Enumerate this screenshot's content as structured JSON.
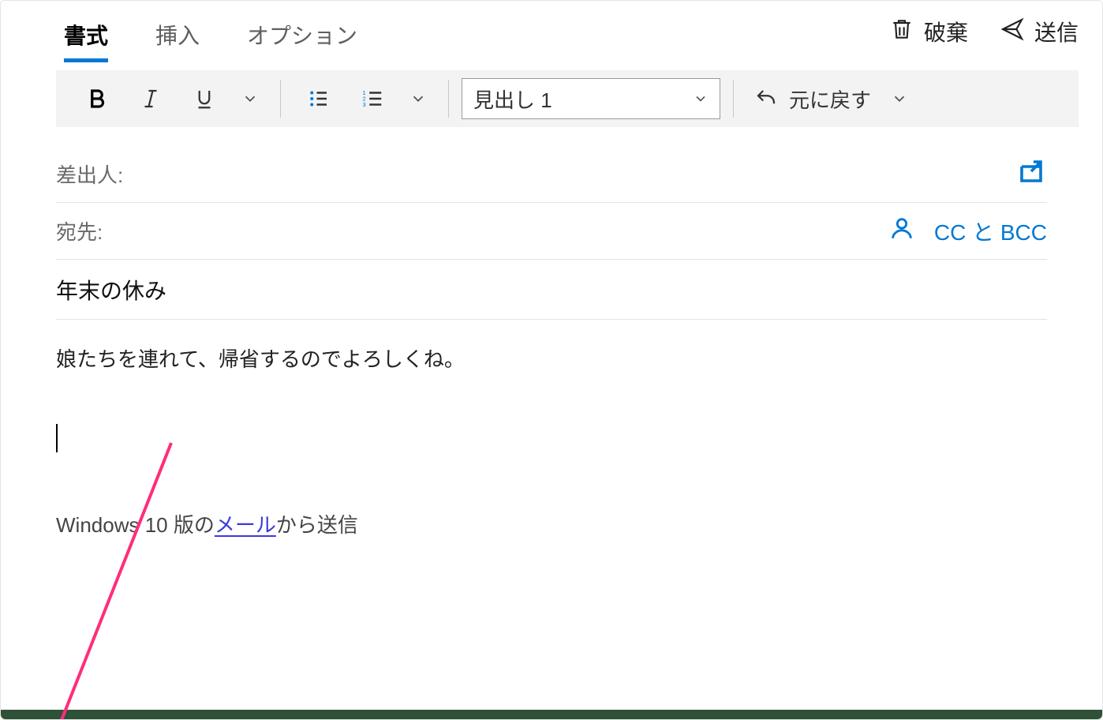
{
  "tabs": {
    "format": "書式",
    "insert": "挿入",
    "options": "オプション"
  },
  "actions": {
    "discard": "破棄",
    "send": "送信"
  },
  "ribbon": {
    "style_selected": "見出し 1",
    "undo_label": "元に戻す"
  },
  "fields": {
    "from_label": "差出人:",
    "to_label": "宛先:",
    "ccbcc": "CC と BCC"
  },
  "subject": "年末の休み",
  "body": {
    "line1": "娘たちを連れて、帰省するのでよろしくね。"
  },
  "signature": {
    "prefix": "Windows 10 版の",
    "link": "メール",
    "suffix": "から送信"
  }
}
